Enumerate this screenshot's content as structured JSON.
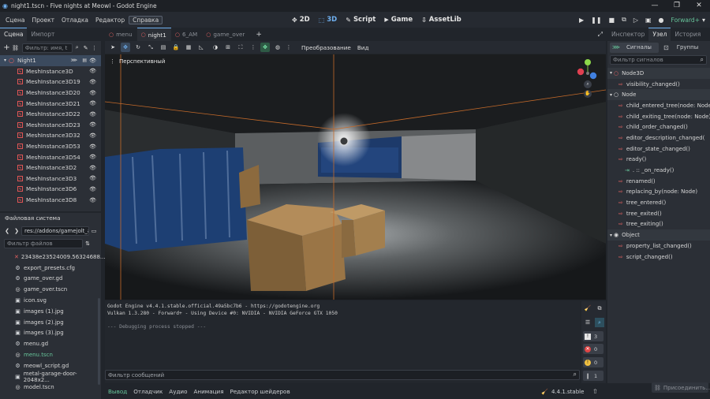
{
  "window": {
    "title": "night1.tscn - Five nights at Meowl - Godot Engine"
  },
  "menu": [
    "Сцена",
    "Проект",
    "Отладка",
    "Редактор",
    "Справка"
  ],
  "menu_active": "Справка",
  "main_screens": [
    {
      "icon": "✥",
      "label": "2D"
    },
    {
      "icon": "⬚",
      "label": "3D"
    },
    {
      "icon": "✎",
      "label": "Script"
    },
    {
      "icon": "🎮",
      "label": "Game"
    },
    {
      "icon": "⇩",
      "label": "AssetLib"
    }
  ],
  "renderer": "Forward+",
  "scene_dock": {
    "tabs": [
      "Сцена",
      "Импорт"
    ],
    "filter_placeholder": "Фильтр: имя, t",
    "root": "Night1",
    "nodes": [
      "MeshInstance3D",
      "MeshInstance3D19",
      "MeshInstance3D20",
      "MeshInstance3D21",
      "MeshInstance3D22",
      "MeshInstance3D23",
      "MeshInstance3D32",
      "MeshInstance3D53",
      "MeshInstance3D54",
      "MeshInstance3D2",
      "MeshInstance3D3",
      "MeshInstance3D6",
      "MeshInstance3D8"
    ]
  },
  "filesystem": {
    "title": "Файловая система",
    "path": "res://addons/gamejolt_api",
    "filter_placeholder": "Фильтр файлов",
    "files": [
      {
        "icon": "✕",
        "name": "23438e23524009.56324688..."
      },
      {
        "icon": "⚙",
        "name": "export_presets.cfg"
      },
      {
        "icon": "⚙",
        "name": "game_over.gd"
      },
      {
        "icon": "◎",
        "name": "game_over.tscn"
      },
      {
        "icon": "▣",
        "name": "icon.svg"
      },
      {
        "icon": "▣",
        "name": "images (1).jpg"
      },
      {
        "icon": "▣",
        "name": "images (2).jpg"
      },
      {
        "icon": "▣",
        "name": "images (3).jpg"
      },
      {
        "icon": "⚙",
        "name": "menu.gd"
      },
      {
        "icon": "◎",
        "name": "menu.tscn",
        "highlight": true
      },
      {
        "icon": "⚙",
        "name": "meowl_script.gd"
      },
      {
        "icon": "▣",
        "name": "metal-garage-door-2048x2..."
      },
      {
        "icon": "◎",
        "name": "model.tscn"
      }
    ]
  },
  "scene_tabs": [
    {
      "label": "menu",
      "active": false
    },
    {
      "label": "night1",
      "active": true
    },
    {
      "label": "6_AM",
      "active": false
    },
    {
      "label": "game_over",
      "active": false
    }
  ],
  "toolbar": {
    "transform": "Преобразование",
    "view": "Вид"
  },
  "viewport": {
    "perspective": "Перспективный"
  },
  "console": {
    "lines": [
      "Godot Engine v4.4.1.stable.official.49a5bc7b6 - https://godotengine.org",
      "Vulkan 1.3.280 - Forward+ - Using Device #0: NVIDIA - NVIDIA GeForce GTX 1050",
      "",
      "--- Debugging process stopped ---"
    ],
    "filter_placeholder": "Фильтр сообщений",
    "counts": {
      "messages": "3",
      "errors": "0",
      "warnings": "0",
      "info": "1"
    }
  },
  "bottom_tabs": [
    "Вывод",
    "Отладчик",
    "Аудио",
    "Анимация",
    "Редактор шейдеров"
  ],
  "version": "4.4.1.stable",
  "right_dock": {
    "tabs": [
      "Инспектор",
      "Узел",
      "История"
    ],
    "subtabs": [
      "Сигналы",
      "Группы"
    ],
    "filter_placeholder": "Фильтр сигналов",
    "rows": [
      {
        "kind": "class",
        "label": "Node3D"
      },
      {
        "kind": "sig",
        "label": "visibility_changed()"
      },
      {
        "kind": "class",
        "label": "Node"
      },
      {
        "kind": "sig",
        "label": "child_entered_tree(node: Node)"
      },
      {
        "kind": "sig",
        "label": "child_exiting_tree(node: Node)"
      },
      {
        "kind": "sig",
        "label": "child_order_changed()"
      },
      {
        "kind": "sig",
        "label": "editor_description_changed("
      },
      {
        "kind": "sig",
        "label": "editor_state_changed()"
      },
      {
        "kind": "sig",
        "label": "ready()"
      },
      {
        "kind": "conn",
        "label": ". :: _on_ready()"
      },
      {
        "kind": "sig",
        "label": "renamed()"
      },
      {
        "kind": "sig",
        "label": "replacing_by(node: Node)"
      },
      {
        "kind": "sig",
        "label": "tree_entered()"
      },
      {
        "kind": "sig",
        "label": "tree_exited()"
      },
      {
        "kind": "sig",
        "label": "tree_exiting()"
      },
      {
        "kind": "class",
        "label": "Object"
      },
      {
        "kind": "sig",
        "label": "property_list_changed()"
      },
      {
        "kind": "sig",
        "label": "script_changed()"
      }
    ],
    "connect_btn": "Присоединить..."
  }
}
